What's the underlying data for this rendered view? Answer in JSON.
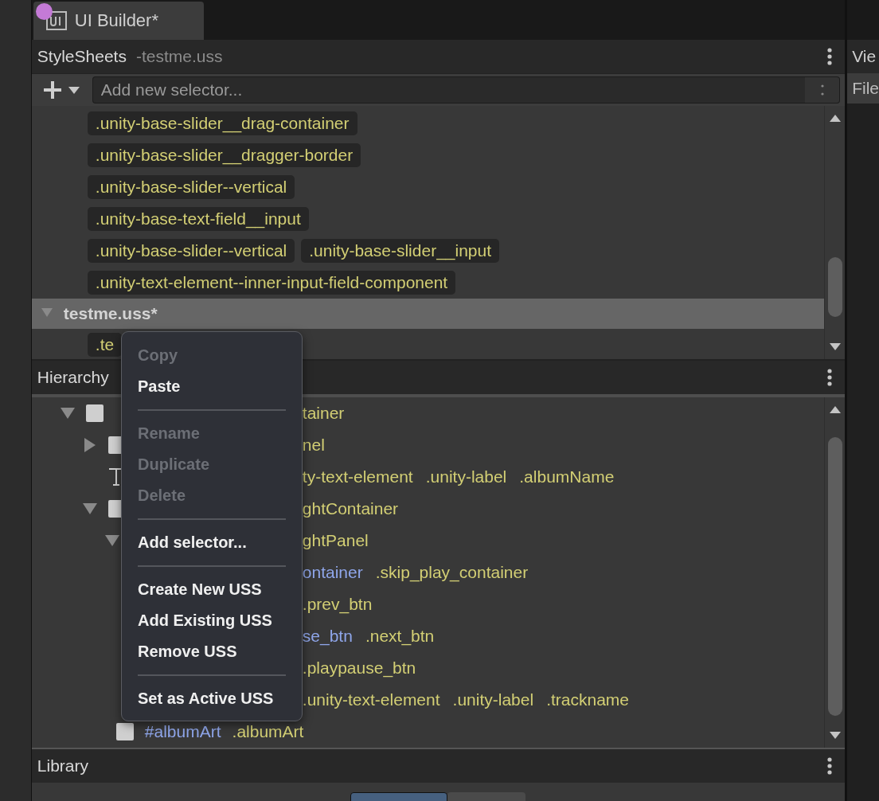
{
  "tab": {
    "title": "UI Builder*"
  },
  "stylesheets": {
    "title": "StyleSheets",
    "subtitle": "-testme.uss",
    "search": {
      "placeholder": "Add new selector..."
    },
    "selector_rows": [
      {
        "selectors": [
          ".unity-base-slider__drag-container"
        ]
      },
      {
        "selectors": [
          ".unity-base-slider__dragger-border"
        ]
      },
      {
        "selectors": [
          ".unity-base-slider--vertical"
        ]
      },
      {
        "selectors": [
          ".unity-base-text-field__input"
        ]
      },
      {
        "selectors": [
          ".unity-base-slider--vertical",
          ".unity-base-slider__input"
        ]
      },
      {
        "selectors": [
          ".unity-text-element--inner-input-field-component"
        ]
      }
    ],
    "sheet": {
      "name": "testme.uss*",
      "expanded": true,
      "selectors": [
        ".te"
      ]
    }
  },
  "hierarchy": {
    "title": "Hierarchy",
    "tree": [
      {
        "expanded": true,
        "kind": "element",
        "tail": [
          {
            "text": "tainer",
            "kind": "class"
          }
        ],
        "children": [
          {
            "expanded": false,
            "kind": "element",
            "tail": [
              {
                "text": "nel",
                "kind": "class"
              }
            ]
          },
          {
            "kind": "text",
            "tail": [
              {
                "text": "ty-text-element",
                "kind": "class"
              },
              {
                "text": ".unity-label",
                "kind": "class"
              },
              {
                "text": ".albumName",
                "kind": "class"
              }
            ]
          },
          {
            "expanded": true,
            "kind": "element",
            "tail": [
              {
                "text": "ghtContainer",
                "kind": "class"
              }
            ],
            "children": [
              {
                "expanded": true,
                "tail": [
                  {
                    "text": "ghtPanel",
                    "kind": "class"
                  }
                ],
                "children": [
                  {
                    "tail": [
                      {
                        "text": "ontainer",
                        "kind": "name"
                      },
                      {
                        "text": ".skip_play_container",
                        "kind": "class"
                      }
                    ],
                    "children": [
                      {
                        "tail": [
                          {
                            "text": ".prev_btn",
                            "kind": "class"
                          }
                        ]
                      },
                      {
                        "tail": [
                          {
                            "text": "se_btn",
                            "kind": "name"
                          },
                          {
                            "text": ".next_btn",
                            "kind": "class"
                          }
                        ]
                      },
                      {
                        "tail": [
                          {
                            "text": ".playpause_btn",
                            "kind": "class"
                          }
                        ]
                      },
                      {
                        "tail": [
                          {
                            "text": ".unity-text-element",
                            "kind": "class"
                          },
                          {
                            "text": ".unity-label",
                            "kind": "class"
                          },
                          {
                            "text": ".trackname",
                            "kind": "class"
                          }
                        ]
                      }
                    ]
                  }
                ]
              },
              {
                "kind": "element",
                "lead": [
                  {
                    "text": "#albumArt",
                    "kind": "name"
                  },
                  {
                    "text": ".albumArt",
                    "kind": "class"
                  }
                ]
              }
            ]
          }
        ]
      }
    ]
  },
  "library": {
    "title": "Library"
  },
  "side_panel": {
    "title": "Vie",
    "row": "File"
  },
  "context_menu": [
    {
      "kind": "item",
      "label": "Copy",
      "disabled": true
    },
    {
      "kind": "item",
      "label": "Paste",
      "disabled": false
    },
    {
      "kind": "separator"
    },
    {
      "kind": "item",
      "label": "Rename",
      "disabled": true
    },
    {
      "kind": "item",
      "label": "Duplicate",
      "disabled": true
    },
    {
      "kind": "item",
      "label": "Delete",
      "disabled": true
    },
    {
      "kind": "separator"
    },
    {
      "kind": "item",
      "label": "Add selector...",
      "disabled": false
    },
    {
      "kind": "separator"
    },
    {
      "kind": "item",
      "label": "Create New USS",
      "disabled": false
    },
    {
      "kind": "item",
      "label": "Add Existing USS",
      "disabled": false
    },
    {
      "kind": "item",
      "label": "Remove USS",
      "disabled": false
    },
    {
      "kind": "separator"
    },
    {
      "kind": "item",
      "label": "Set as Active USS",
      "disabled": false
    }
  ]
}
